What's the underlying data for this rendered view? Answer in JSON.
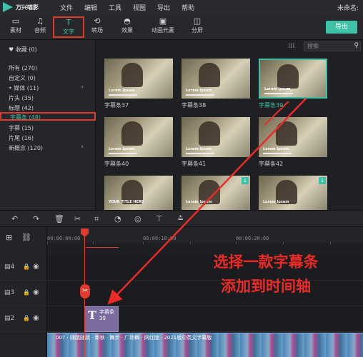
{
  "app": {
    "name": "万兴喵影",
    "project_name": "未命名:"
  },
  "menu": [
    "文件",
    "编辑",
    "工具",
    "视图",
    "导出",
    "帮助"
  ],
  "toolbar": {
    "items": [
      {
        "label": "素材",
        "icon": "folder-icon"
      },
      {
        "label": "音频",
        "icon": "music-note-icon"
      },
      {
        "label": "文字",
        "icon": "text-icon",
        "active": true
      },
      {
        "label": "转场",
        "icon": "transition-icon"
      },
      {
        "label": "效果",
        "icon": "effects-icon"
      },
      {
        "label": "动画元素",
        "icon": "image-icon"
      },
      {
        "label": "分屏",
        "icon": "split-screen-icon"
      }
    ],
    "export_label": "导出"
  },
  "sidebar": {
    "favorites": "收藏 (0)",
    "categories": [
      {
        "label": "所有 (270)"
      },
      {
        "label": "自定义 (0)"
      },
      {
        "label": "• 媒体 (11)",
        "expandable": true
      },
      {
        "label": "片头 (35)"
      },
      {
        "label": "标题 (42)"
      },
      {
        "label": "字幕条 (48)",
        "selected": true
      },
      {
        "label": "字幕 (15)"
      },
      {
        "label": "片尾 (16)"
      },
      {
        "label": "新概念 (120)",
        "expandable": true
      }
    ]
  },
  "search": {
    "placeholder": "搜索"
  },
  "templates": [
    {
      "label": "字幕条37",
      "text": "Lorem Ipsum"
    },
    {
      "label": "字幕条38",
      "text": "Lorem Ipsum"
    },
    {
      "label": "字幕条39",
      "text": "Lorem Ipsum",
      "selected": true
    },
    {
      "label": "字幕条40",
      "text": "Lorem Ipsum"
    },
    {
      "label": "字幕条41",
      "text": "Lorem Ipsum"
    },
    {
      "label": "字幕条42",
      "text": "Lorem Ipsum"
    },
    {
      "label": "",
      "text": "YOUR TITLE HERE"
    },
    {
      "label": "",
      "text": "Lorem Ipsum"
    },
    {
      "label": "",
      "text": "Lorem Ipsum"
    }
  ],
  "timeline": {
    "ruler": [
      "00:00:00:00",
      "00:00:10:00",
      "00:00:20:00"
    ],
    "tracks": [
      {
        "number": "4"
      },
      {
        "number": "3"
      },
      {
        "number": "2"
      }
    ],
    "title_clip_label": "字幕条39",
    "video_clip_text": "007 · 随跳随跳 · 新秋 · 舞步 · 广场舞 · 网红版 · 2021版中英文字幕版"
  },
  "annotation": {
    "line1": "选择一款字幕条",
    "line2": "添加到时间轴"
  },
  "colors": {
    "accent": "#3ec1a7",
    "highlight": "#e23a2d",
    "annotation": "#ec2b26"
  }
}
